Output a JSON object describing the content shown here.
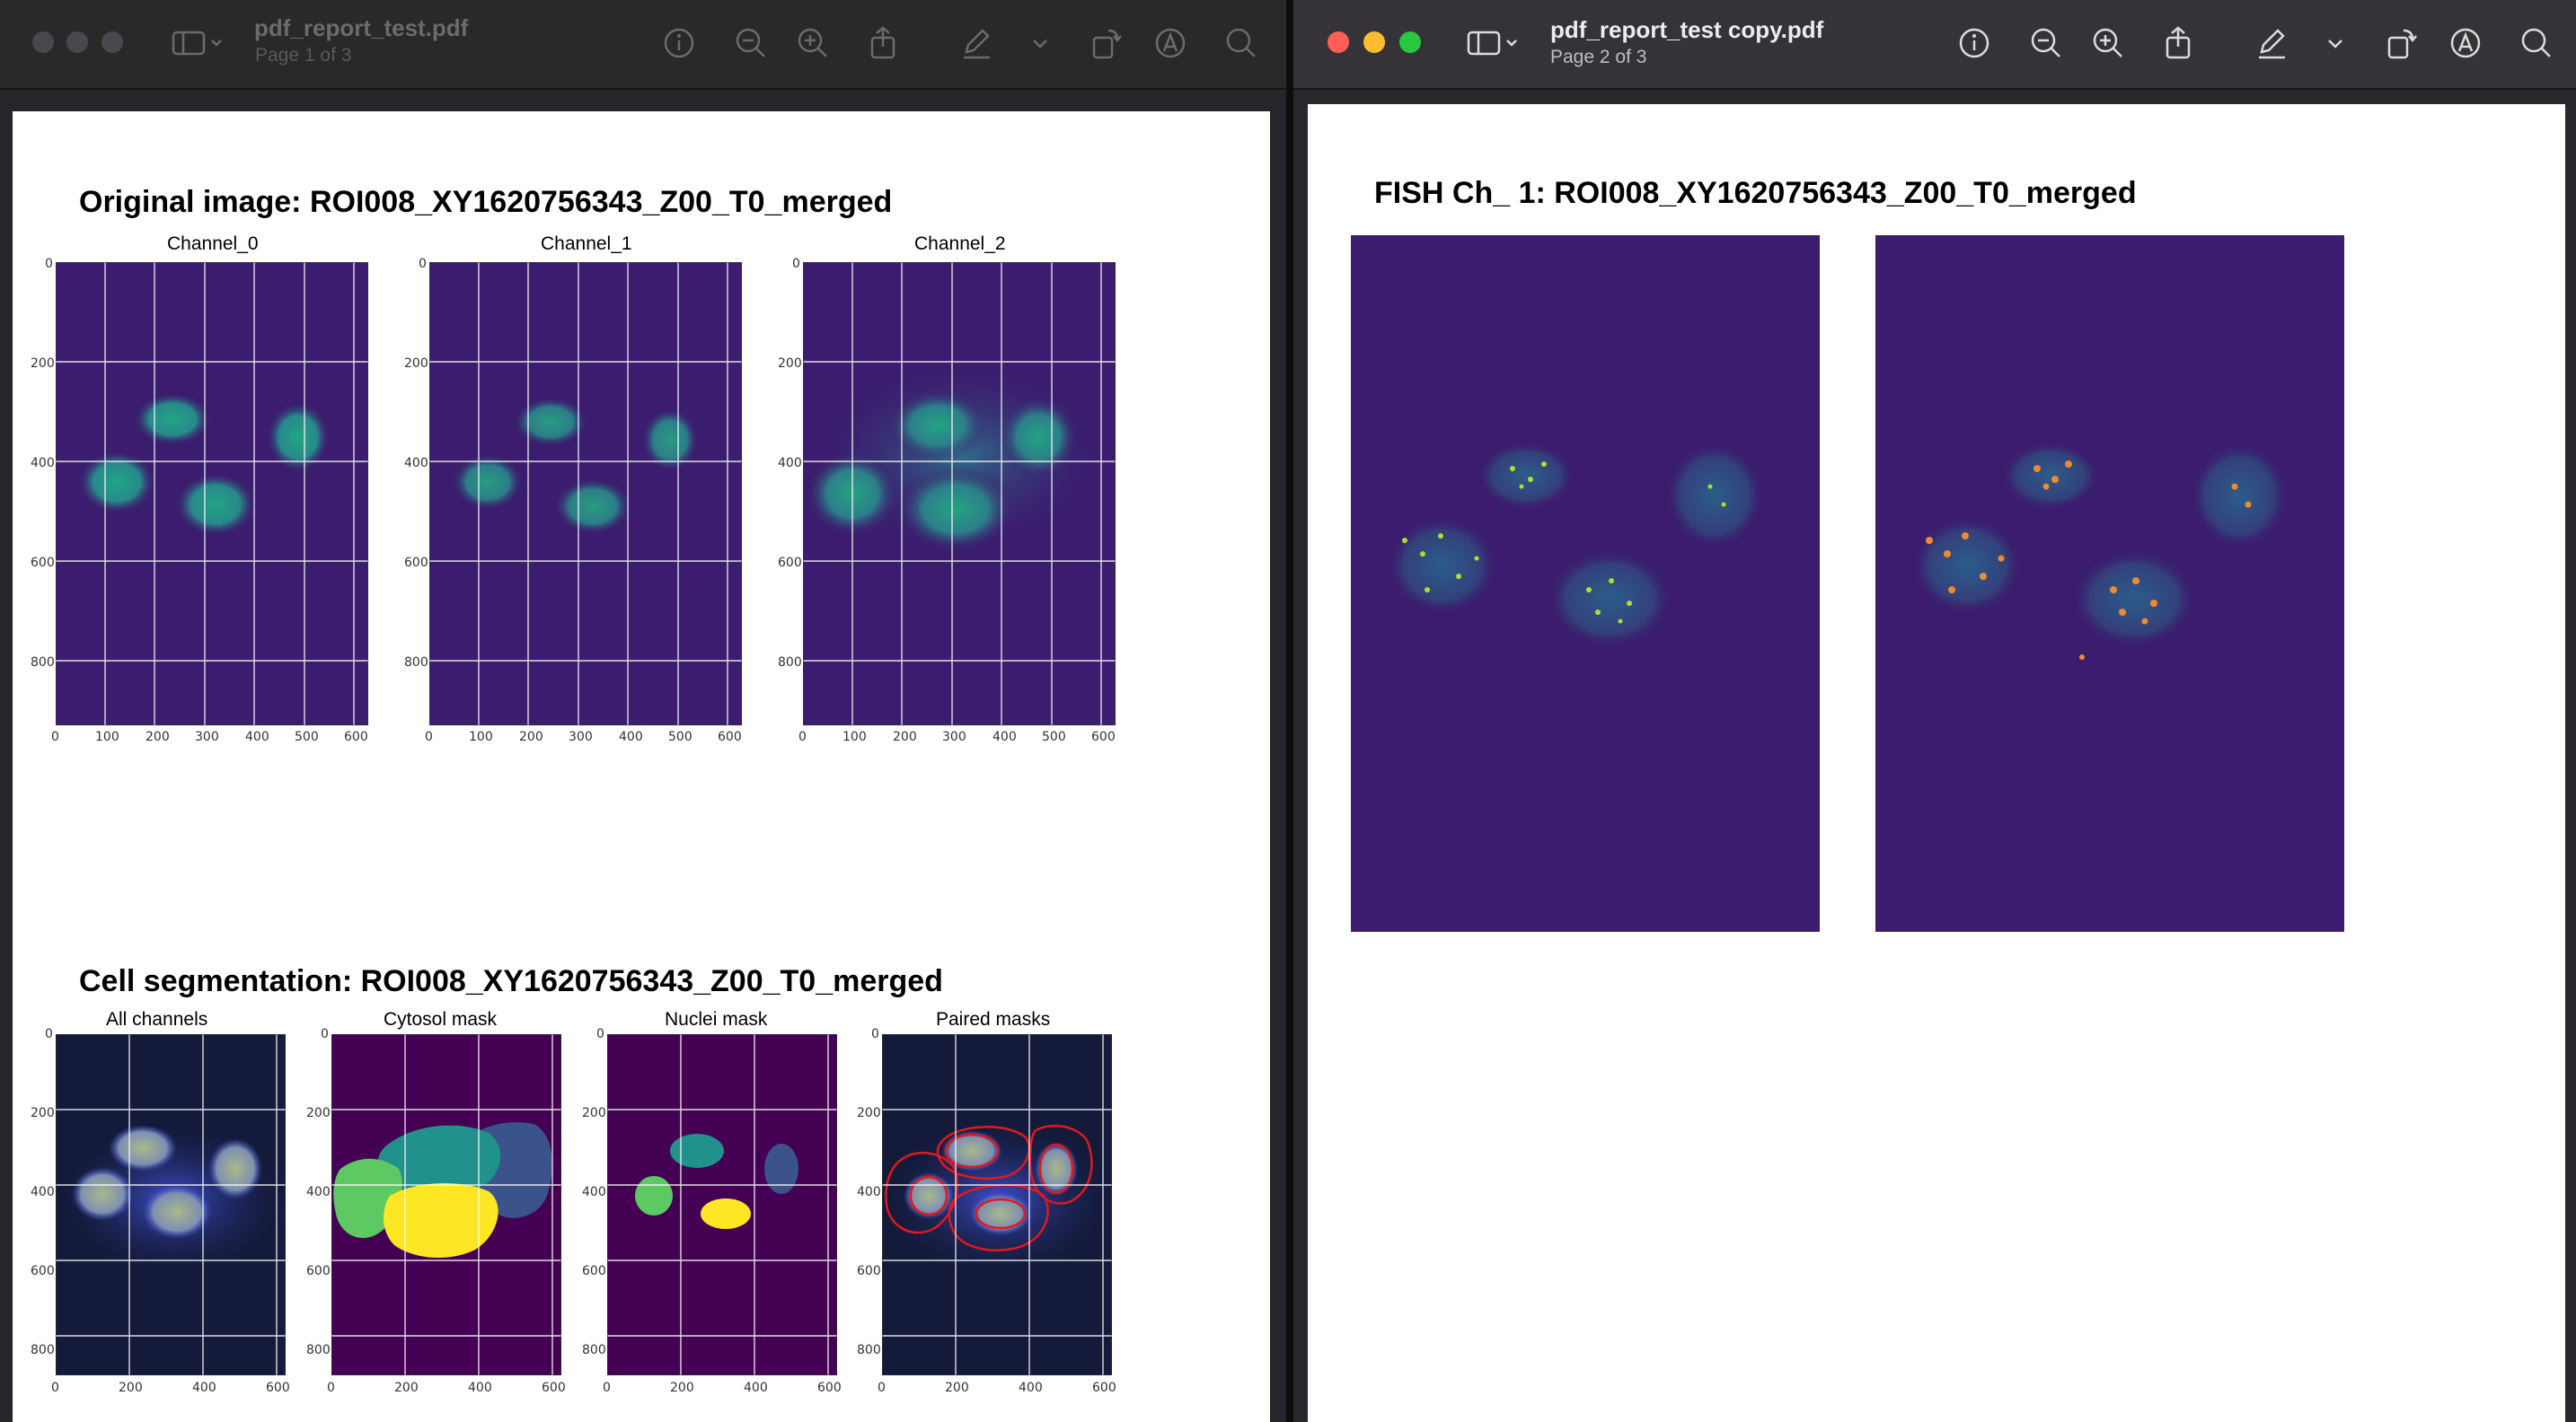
{
  "left_window": {
    "title": "pdf_report_test.pdf",
    "subtitle": "Page 1 of 3",
    "page": {
      "section1_title": "Original image: ROI008_XY1620756343_Z00_T0_merged",
      "section1_panels": [
        {
          "title": "Channel_0",
          "x_ticks": [
            "0",
            "100",
            "200",
            "300",
            "400",
            "500",
            "600"
          ],
          "y_ticks": [
            "0",
            "200",
            "400",
            "600",
            "800"
          ]
        },
        {
          "title": "Channel_1",
          "x_ticks": [
            "0",
            "100",
            "200",
            "300",
            "400",
            "500",
            "600"
          ],
          "y_ticks": [
            "0",
            "200",
            "400",
            "600",
            "800"
          ]
        },
        {
          "title": "Channel_2",
          "x_ticks": [
            "0",
            "100",
            "200",
            "300",
            "400",
            "500",
            "600"
          ],
          "y_ticks": [
            "0",
            "200",
            "400",
            "600",
            "800"
          ]
        }
      ],
      "section2_title": "Cell segmentation: ROI008_XY1620756343_Z00_T0_merged",
      "section2_panels": [
        {
          "title": "All channels",
          "x_ticks": [
            "0",
            "200",
            "400",
            "600"
          ],
          "y_ticks": [
            "0",
            "200",
            "400",
            "600",
            "800"
          ]
        },
        {
          "title": "Cytosol mask",
          "x_ticks": [
            "0",
            "200",
            "400",
            "600"
          ],
          "y_ticks": [
            "0",
            "200",
            "400",
            "600",
            "800"
          ]
        },
        {
          "title": "Nuclei mask",
          "x_ticks": [
            "0",
            "200",
            "400",
            "600"
          ],
          "y_ticks": [
            "0",
            "200",
            "400",
            "600",
            "800"
          ]
        },
        {
          "title": "Paired masks",
          "x_ticks": [
            "0",
            "200",
            "400",
            "600"
          ],
          "y_ticks": [
            "0",
            "200",
            "400",
            "600",
            "800"
          ]
        }
      ]
    }
  },
  "right_window": {
    "title": "pdf_report_test copy.pdf",
    "subtitle": "Page 2 of 3",
    "page": {
      "section_title": "FISH Ch_ 1: ROI008_XY1620756343_Z00_T0_merged"
    }
  },
  "toolbar_icons": [
    "sidebar-icon",
    "chevron-down-icon",
    "info-icon",
    "zoom-out-icon",
    "zoom-in-icon",
    "share-icon",
    "markup-pen-icon",
    "chevron-down-icon",
    "rotate-icon",
    "annotate-icon",
    "search-icon"
  ],
  "colors": {
    "traffic_red": "#ff5f57",
    "traffic_yellow": "#febc2e",
    "traffic_green": "#28c840",
    "traffic_inactive": "#4a484c",
    "image_background": "#3b1c6e",
    "mask_background": "#440154",
    "mask_outline": "#e0191c"
  }
}
